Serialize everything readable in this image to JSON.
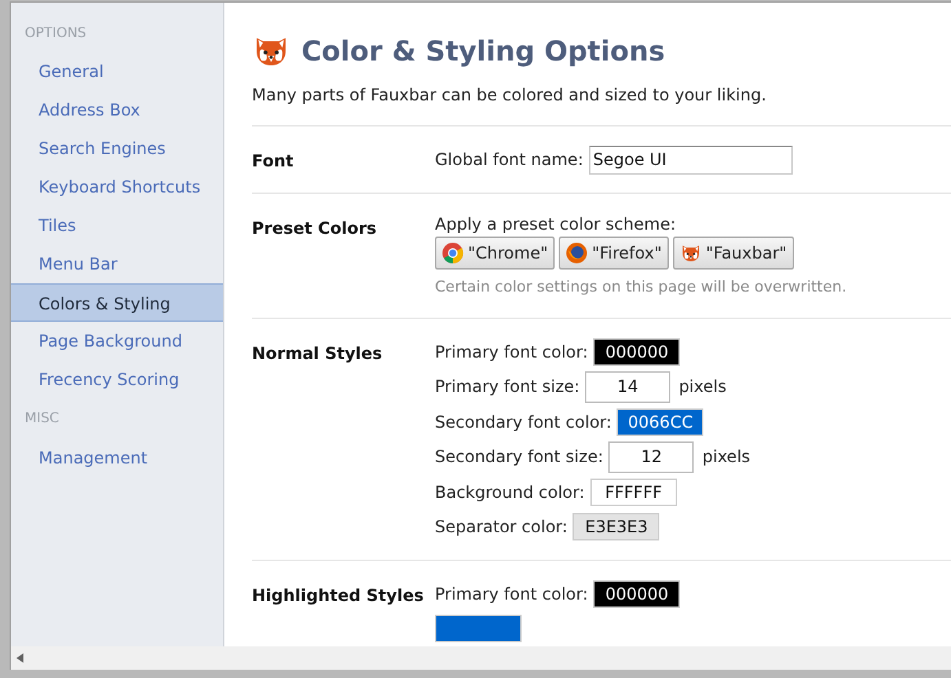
{
  "sidebar": {
    "groups": [
      {
        "heading": "OPTIONS",
        "items": [
          {
            "label": "General",
            "selected": false
          },
          {
            "label": "Address Box",
            "selected": false
          },
          {
            "label": "Search Engines",
            "selected": false
          },
          {
            "label": "Keyboard Shortcuts",
            "selected": false
          },
          {
            "label": "Tiles",
            "selected": false
          },
          {
            "label": "Menu Bar",
            "selected": false
          },
          {
            "label": "Colors & Styling",
            "selected": true
          },
          {
            "label": "Page Background",
            "selected": false
          },
          {
            "label": "Frecency Scoring",
            "selected": false
          }
        ]
      },
      {
        "heading": "MISC",
        "items": [
          {
            "label": "Management",
            "selected": false
          }
        ]
      }
    ]
  },
  "page": {
    "title": "Color & Styling Options",
    "description": "Many parts of Fauxbar can be colored and sized to your liking."
  },
  "sections": [
    {
      "title": "Font",
      "rows": [
        {
          "kind": "text",
          "label": "Global font name:",
          "value": "Segoe UI"
        }
      ]
    },
    {
      "title": "Preset Colors",
      "rows": [
        {
          "kind": "presets",
          "label": "Apply a preset color scheme:",
          "buttons": [
            {
              "label": "\"Chrome\""
            },
            {
              "label": "\"Firefox\""
            },
            {
              "label": "\"Fauxbar\""
            }
          ],
          "note": "Certain color settings on this page will be overwritten."
        }
      ]
    },
    {
      "title": "Normal Styles",
      "rows": [
        {
          "kind": "color",
          "label": "Primary font color:",
          "value": "000000",
          "color": "#000000"
        },
        {
          "kind": "size",
          "label": "Primary font size:",
          "value": "14",
          "unit": "pixels"
        },
        {
          "kind": "color",
          "label": "Secondary font color:",
          "value": "0066CC",
          "color": "#0066cc"
        },
        {
          "kind": "size",
          "label": "Secondary font size:",
          "value": "12",
          "unit": "pixels"
        },
        {
          "kind": "color",
          "label": "Background color:",
          "value": "FFFFFF",
          "color": "#ffffff"
        },
        {
          "kind": "color",
          "label": "Separator color:",
          "value": "E3E3E3",
          "color": "#e3e3e3"
        }
      ]
    },
    {
      "title": "Highlighted Styles",
      "rows": [
        {
          "kind": "color",
          "label": "Primary font color:",
          "value": "000000",
          "color": "#000000"
        },
        {
          "kind": "color",
          "color": "#0066cc"
        }
      ]
    }
  ]
}
